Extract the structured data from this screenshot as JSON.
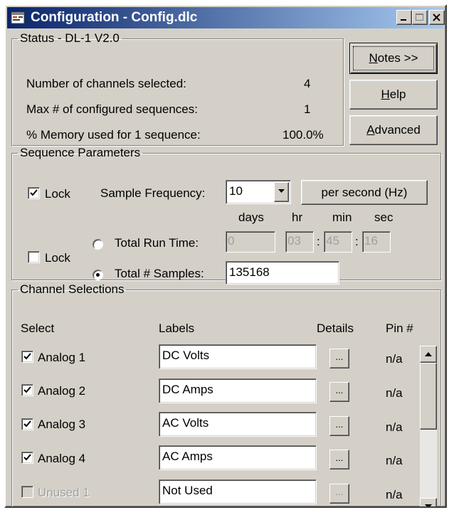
{
  "window": {
    "title": "Configuration - Config.dlc"
  },
  "status": {
    "legend": "Status - DL-1 V2.0",
    "rows": [
      {
        "label": "Number of channels selected:",
        "value": "4"
      },
      {
        "label": "Max # of configured sequences:",
        "value": "1"
      },
      {
        "label": "% Memory used for 1 sequence:",
        "value": "100.0%"
      }
    ]
  },
  "buttons": {
    "notes": {
      "mnemonic": "N",
      "rest": "otes >>"
    },
    "help": {
      "mnemonic": "H",
      "rest": "elp"
    },
    "advanced": {
      "mnemonic": "A",
      "rest": "dvanced"
    }
  },
  "sequence": {
    "legend": "Sequence Parameters",
    "lock1_label": "Lock",
    "lock1_checked": true,
    "sample_freq_label": "Sample Frequency:",
    "sample_freq_value": "10",
    "unit_button": "per second (Hz)",
    "col_days": "days",
    "col_hr": "hr",
    "col_min": "min",
    "col_sec": "sec",
    "lock2_label": "Lock",
    "lock2_checked": false,
    "total_run_time_label": "Total Run Time:",
    "run_days": "0",
    "run_hr": "03",
    "run_min": "45",
    "run_sec": "16",
    "sep": ":",
    "total_samples_label": "Total # Samples:",
    "total_samples_value": "135168",
    "selected_mode": "total_samples"
  },
  "channels": {
    "legend": "Channel Selections",
    "headers": {
      "select": "Select",
      "labels": "Labels",
      "details": "Details",
      "pin": "Pin #"
    },
    "details_button": "...",
    "rows": [
      {
        "name": "Analog 1",
        "label": "DC Volts",
        "pin": "n/a",
        "checked": true,
        "enabled": true
      },
      {
        "name": "Analog 2",
        "label": "DC Amps",
        "pin": "n/a",
        "checked": true,
        "enabled": true
      },
      {
        "name": "Analog 3",
        "label": "AC Volts",
        "pin": "n/a",
        "checked": true,
        "enabled": true
      },
      {
        "name": "Analog 4",
        "label": "AC Amps",
        "pin": "n/a",
        "checked": true,
        "enabled": true
      },
      {
        "name": "Unused 1",
        "label": "Not Used",
        "pin": "n/a",
        "checked": false,
        "enabled": false
      }
    ]
  },
  "colors": {
    "face": "#d4d0c8",
    "title_start": "#0a246a",
    "title_end": "#a6caf0"
  }
}
